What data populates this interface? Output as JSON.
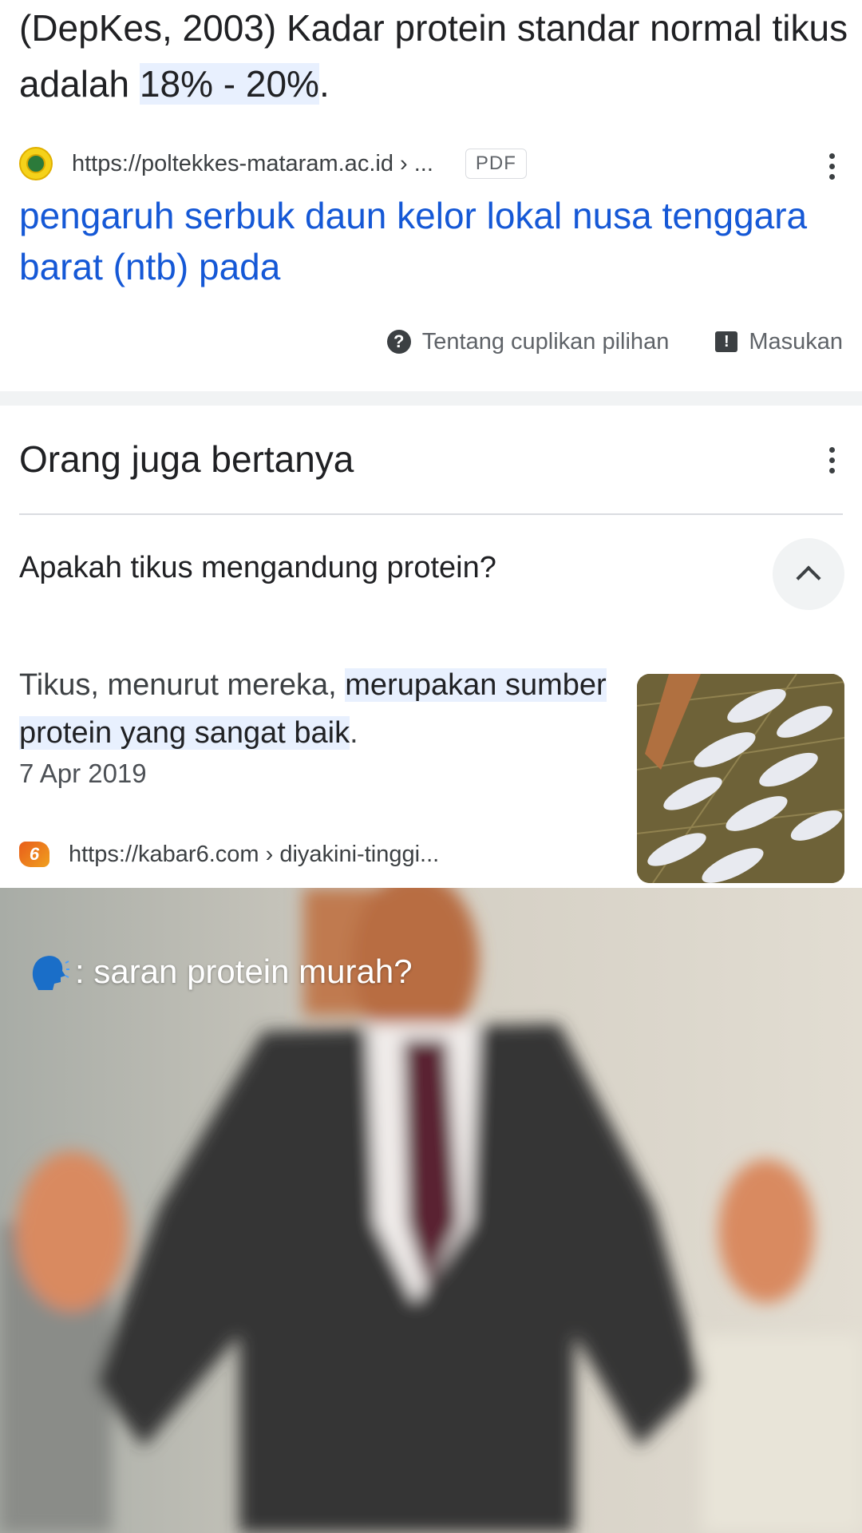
{
  "snippet": {
    "text_before": "(DepKes, 2003) Kadar protein standar normal tikus adalah ",
    "highlight": "18% - 20%",
    "text_after": "."
  },
  "source1": {
    "url": "https://poltekkes-mataram.ac.id › ...",
    "badge": "PDF",
    "title": "pengaruh serbuk daun kelor lokal nusa tenggara barat (ntb) pada"
  },
  "about": {
    "about_label": "Tentang cuplikan pilihan",
    "feedback_label": "Masukan"
  },
  "paa": {
    "heading": "Orang juga bertanya",
    "question": "Apakah tikus mengandung protein?",
    "answer_before": "Tikus, menurut mereka, ",
    "answer_highlight": "merupakan sumber protein yang sangat baik",
    "answer_after": ".",
    "date": "7 Apr 2019",
    "source_url": "https://kabar6.com › diyakini-tinggi..."
  },
  "video": {
    "caption": ": saran protein murah?"
  },
  "colors": {
    "link": "#1558d6",
    "highlight": "#e8f0fe",
    "band": "#f1f3f4"
  }
}
